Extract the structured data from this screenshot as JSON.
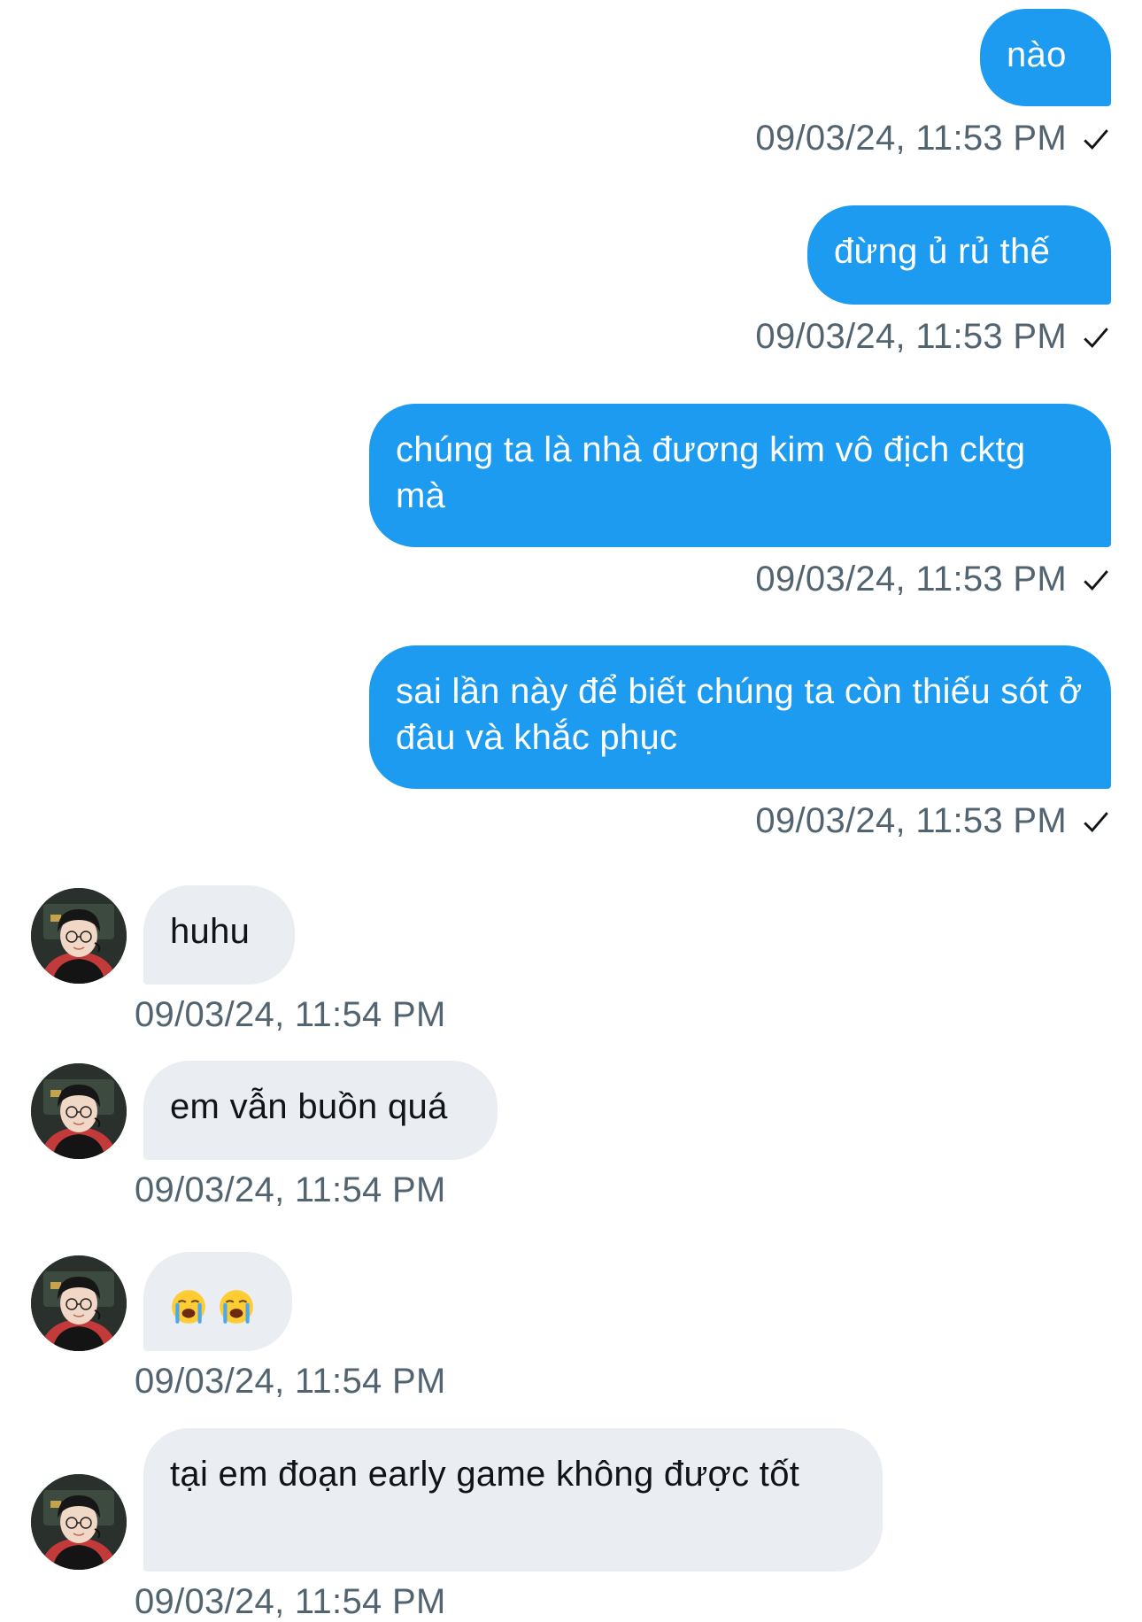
{
  "messages": [
    {
      "direction": "sent",
      "text": "nào",
      "time": "09/03/24, 11:53 PM"
    },
    {
      "direction": "sent",
      "text": "đừng ủ rủ thế",
      "time": "09/03/24, 11:53 PM"
    },
    {
      "direction": "sent",
      "text": "chúng ta là nhà đương kim vô địch cktg mà",
      "time": "09/03/24, 11:53 PM"
    },
    {
      "direction": "sent",
      "text": "sai lần này để biết chúng ta còn thiếu sót ở đâu và khắc phục",
      "time": "09/03/24, 11:53 PM"
    },
    {
      "direction": "received",
      "text": "huhu",
      "time": "09/03/24, 11:54 PM"
    },
    {
      "direction": "received",
      "text": "em vẫn buồn quá",
      "time": "09/03/24, 11:54 PM"
    },
    {
      "direction": "received",
      "text": "😭😭",
      "emoji_icons": [
        "loudly-crying-face-icon",
        "loudly-crying-face-icon"
      ],
      "time": "09/03/24, 11:54 PM"
    },
    {
      "direction": "received",
      "text": "tại em đoạn early game không được tốt",
      "time": "09/03/24, 11:54 PM"
    }
  ],
  "status_icon": "check-icon",
  "colors": {
    "sent_bubble": "#1d9bf0",
    "received_bubble": "#eaedf1",
    "timestamp": "#536471",
    "sent_text": "#ffffff",
    "received_text": "#0f1419"
  }
}
